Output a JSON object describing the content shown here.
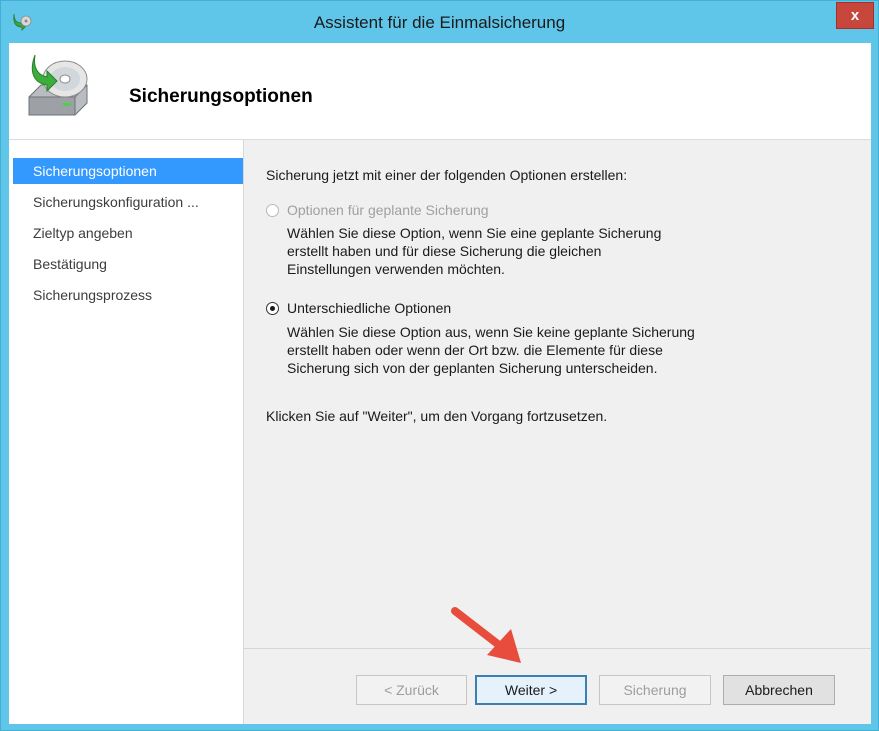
{
  "window": {
    "title": "Assistent für die Einmalsicherung",
    "close_label": "x"
  },
  "header": {
    "title": "Sicherungsoptionen"
  },
  "sidebar": {
    "items": [
      {
        "label": "Sicherungsoptionen",
        "selected": true
      },
      {
        "label": "Sicherungskonfiguration ..."
      },
      {
        "label": "Zieltyp angeben"
      },
      {
        "label": "Bestätigung"
      },
      {
        "label": "Sicherungsprozess"
      }
    ]
  },
  "content": {
    "intro": "Sicherung jetzt mit einer der folgenden Optionen erstellen:",
    "options": [
      {
        "label": "Optionen für geplante Sicherung",
        "enabled": false,
        "selected": false,
        "description": [
          "Wählen Sie diese Option, wenn Sie eine geplante Sicherung",
          "erstellt haben und für diese Sicherung die gleichen",
          "Einstellungen verwenden möchten."
        ]
      },
      {
        "label": "Unterschiedliche Optionen",
        "enabled": true,
        "selected": true,
        "description": [
          "Wählen Sie diese Option aus, wenn Sie keine geplante Sicherung",
          "erstellt haben oder wenn der Ort bzw. die Elemente für diese",
          "Sicherung sich von der geplanten Sicherung unterscheiden."
        ]
      }
    ],
    "continue_hint": "Klicken Sie auf \"Weiter\", um den Vorgang fortzusetzen."
  },
  "buttons": {
    "back": "< Zurück",
    "next": "Weiter >",
    "backup": "Sicherung",
    "cancel": "Abbrechen"
  },
  "colors": {
    "titlebar": "#5fc6ea",
    "selection": "#3399ff",
    "close": "#c7473c",
    "annotation_arrow": "#e74c3c"
  }
}
